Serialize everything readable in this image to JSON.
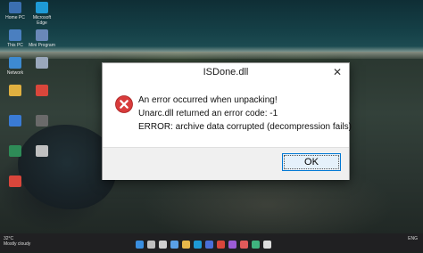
{
  "dialog": {
    "title": "ISDone.dll",
    "close_glyph": "✕",
    "icon": "error-icon",
    "message_lines": [
      "An error occurred when unpacking!",
      "Unarc.dll returned an error code: -1",
      "ERROR: archive data corrupted (decompression fails)"
    ],
    "ok_label": "OK"
  },
  "desktop": {
    "icons": [
      {
        "label": "Home PC",
        "icon": "pc-icon",
        "color": "#3b6fb0"
      },
      {
        "label": "Microsoft Edge",
        "icon": "edge-icon",
        "color": "#1e9ad6"
      },
      {
        "label": "This PC",
        "icon": "computer-icon",
        "color": "#4a7fc0"
      },
      {
        "label": "Mini Program",
        "icon": "app-icon",
        "color": "#6a88b8"
      },
      {
        "label": "Network",
        "icon": "network-icon",
        "color": "#3d8ad1"
      },
      {
        "label": "",
        "icon": "app-icon",
        "color": "#9aa8bc"
      },
      {
        "label": "",
        "icon": "folder-icon",
        "color": "#e0b040"
      },
      {
        "label": "",
        "icon": "chrome-icon",
        "color": "#d9463b"
      },
      {
        "label": "",
        "icon": "mail-icon",
        "color": "#3a7bd5"
      },
      {
        "label": "",
        "icon": "app-icon",
        "color": "#6a6a6a"
      },
      {
        "label": "",
        "icon": "app-icon",
        "color": "#2e8b57"
      },
      {
        "label": "",
        "icon": "app-icon",
        "color": "#c0c0c0"
      },
      {
        "label": "",
        "icon": "chrome-icon",
        "color": "#d9463b"
      }
    ]
  },
  "taskbar": {
    "weather_line1": "32°C",
    "weather_line2": "Mostly cloudy",
    "language": "ENG",
    "time": "",
    "apps": [
      {
        "icon": "start-icon",
        "color": "#3a8fe0"
      },
      {
        "icon": "search-icon",
        "color": "#bfbfbf"
      },
      {
        "icon": "taskview-icon",
        "color": "#d0d0d0"
      },
      {
        "icon": "widgets-icon",
        "color": "#5aa0e6"
      },
      {
        "icon": "explorer-icon",
        "color": "#e8b84a"
      },
      {
        "icon": "edge-icon",
        "color": "#1e9ad6"
      },
      {
        "icon": "store-icon",
        "color": "#4b6fd8"
      },
      {
        "icon": "chrome-icon",
        "color": "#d9463b"
      },
      {
        "icon": "app-icon",
        "color": "#9c5cd6"
      },
      {
        "icon": "app-icon",
        "color": "#e05a5a"
      },
      {
        "icon": "app-icon",
        "color": "#3fb37f"
      },
      {
        "icon": "app-icon",
        "color": "#dddddd"
      }
    ]
  },
  "colors": {
    "accent": "#0078d4",
    "error_red": "#d83b3b"
  }
}
